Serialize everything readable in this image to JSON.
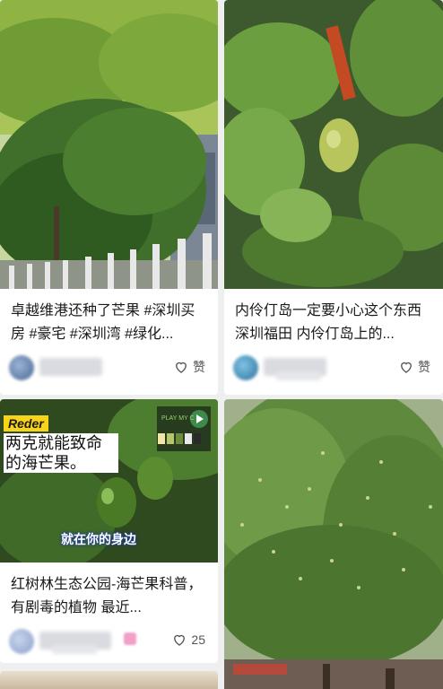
{
  "feed": {
    "cards": [
      {
        "title": "卓越维港还种了芒果 #深圳买房 #豪宅 #深圳湾 #绿化...",
        "image_caption": "",
        "like_label": "赞",
        "author": ""
      },
      {
        "title": "内伶仃岛一定要小心这个东西深圳福田 内伶仃岛上的...",
        "like_label": "赞",
        "author": ""
      },
      {
        "title": "红树林生态公园-海芒果科普，有剧毒的植物 最近...",
        "overlay_tag": "Reder",
        "overlay_headline": "两克就能致命的海芒果。",
        "overlay_subtitle": "就在你的身边",
        "overlay_play": "PLAY MY C",
        "like_label": "25",
        "author": ""
      },
      {
        "title": "",
        "author": ""
      }
    ]
  },
  "colors": {
    "background": "#efefef",
    "text": "#1a1a1a",
    "like": "#555555"
  },
  "icons": {
    "like": "heart-outline-icon",
    "play": "play-icon"
  }
}
